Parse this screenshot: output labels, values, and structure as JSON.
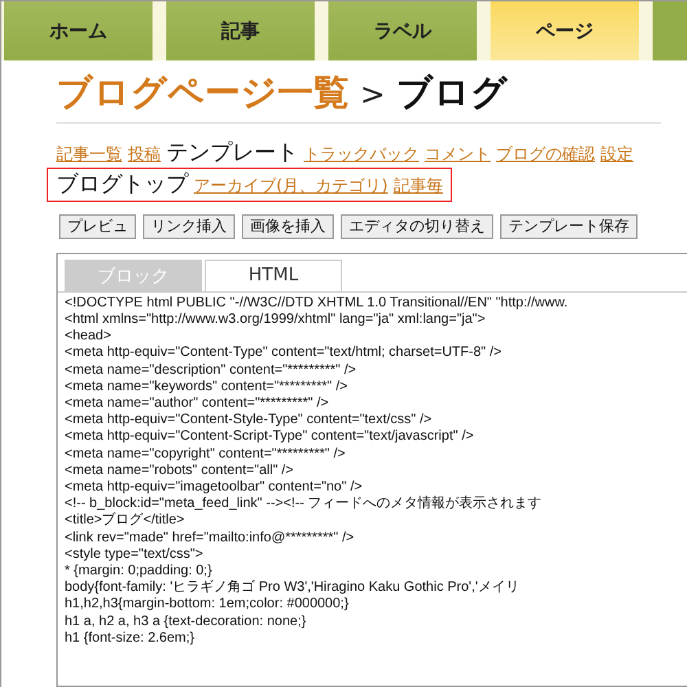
{
  "nav": {
    "tabs": [
      {
        "label": "ホーム",
        "selected": false
      },
      {
        "label": "記事",
        "selected": false
      },
      {
        "label": "ラベル",
        "selected": false
      },
      {
        "label": "ページ",
        "selected": true
      }
    ]
  },
  "heading": {
    "parent": "ブログページ一覧",
    "separator": ">",
    "current": "ブログ"
  },
  "section_nav": [
    {
      "label": "記事一覧",
      "selected": false
    },
    {
      "label": "投稿",
      "selected": false
    },
    {
      "label": "テンプレート",
      "selected": true
    },
    {
      "label": "トラックバック",
      "selected": false
    },
    {
      "label": "コメント",
      "selected": false
    },
    {
      "label": "ブログの確認",
      "selected": false
    },
    {
      "label": "設定",
      "selected": false
    }
  ],
  "template_nav": [
    {
      "label": "ブログトップ",
      "selected": true
    },
    {
      "label": "アーカイブ(月、カテゴリ)",
      "selected": false
    },
    {
      "label": "記事毎",
      "selected": false
    }
  ],
  "toolbar": [
    "プレビュ",
    "リンク挿入",
    "画像を挿入",
    "エディタの切り替え",
    "テンプレート保存"
  ],
  "editor": {
    "tabs": [
      {
        "label": "ブロック",
        "selected": false
      },
      {
        "label": "HTML",
        "selected": true
      }
    ],
    "code_lines": [
      "<!DOCTYPE html PUBLIC \"-//W3C//DTD XHTML 1.0 Transitional//EN\" \"http://www.",
      "<html xmlns=\"http://www.w3.org/1999/xhtml\" lang=\"ja\" xml:lang=\"ja\">",
      "<head>",
      "<meta http-equiv=\"Content-Type\" content=\"text/html; charset=UTF-8\" />",
      "<meta name=\"description\" content=\"*********\" />",
      "<meta name=\"keywords\" content=\"*********\" />",
      "<meta name=\"author\" content=\"*********\" />",
      "<meta http-equiv=\"Content-Style-Type\" content=\"text/css\" />",
      "<meta http-equiv=\"Content-Script-Type\" content=\"text/javascript\" />",
      "<meta name=\"copyright\" content=\"*********\" />",
      "<meta name=\"robots\" content=\"all\" />",
      "<meta http-equiv=\"imagetoolbar\" content=\"no\" />",
      "<!-- b_block:id=\"meta_feed_link\" --><!-- フィードへのメタ情報が表示されます",
      "<title>ブログ</title>",
      "<link rev=\"made\" href=\"mailto:info@*********\" />",
      "<style type=\"text/css\">",
      "* {margin: 0;padding: 0;}",
      "body{font-family: 'ヒラギノ角ゴ Pro W3','Hiragino Kaku Gothic Pro','メイリ",
      "h1,h2,h3{margin-bottom: 1em;color: #000000;}",
      "h1 a, h2 a, h3 a {text-decoration: none;}",
      "h1 {font-size: 2.6em;}"
    ]
  }
}
